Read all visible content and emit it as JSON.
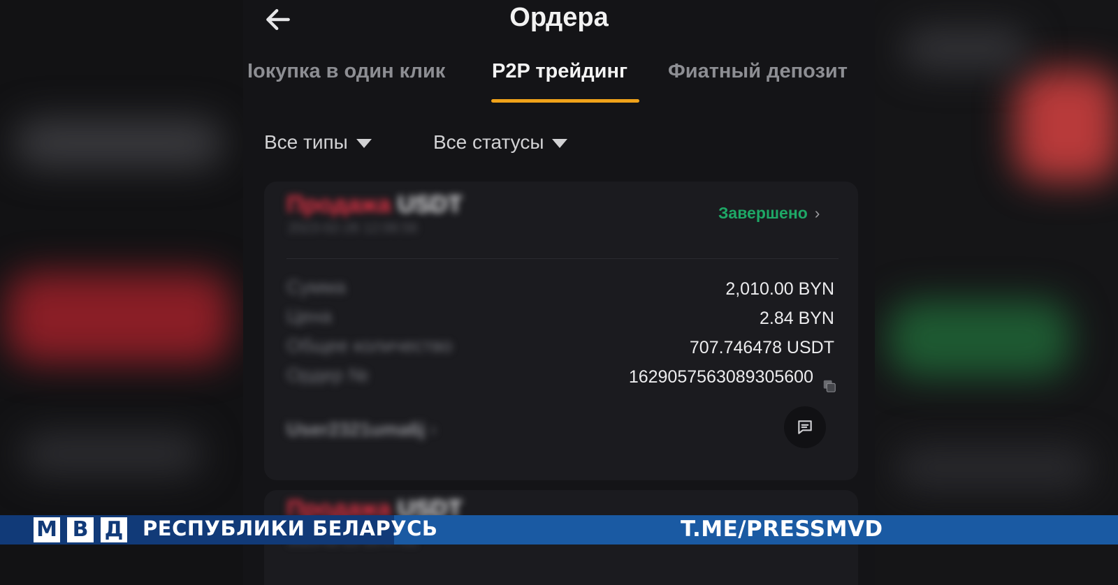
{
  "header": {
    "title": "Ордера"
  },
  "tabs": [
    {
      "label": "Іокупка в один клик"
    },
    {
      "label": "P2P трейдинг",
      "active": true
    },
    {
      "label": "Фиатный депозит"
    }
  ],
  "filters": {
    "type": "Все типы",
    "status": "Все статусы"
  },
  "order": {
    "type_sell": "Продажа",
    "asset": "USDT",
    "date": "2023-02-26 12:06:56",
    "status": "Завершено",
    "status_chevron": "›",
    "rows": [
      {
        "label": "Сумма",
        "value": "2,010.00 BYN"
      },
      {
        "label": "Цена",
        "value": "2.84 BYN"
      },
      {
        "label": "Общее количество",
        "value": "707.746478 USDT"
      },
      {
        "label": "Ордер №",
        "value": "1629057563089305600"
      }
    ],
    "user": "User2321uma6j",
    "user_chevron": "›"
  },
  "order2": {
    "type_sell": "Продажа",
    "asset": "USDT",
    "date": "2023-02-25 18:47:01"
  },
  "banner": {
    "letters": [
      "М",
      "В",
      "Д"
    ],
    "org": "РЕСПУБЛИКИ БЕЛАРУСЬ",
    "link": "T.ME/PRESSMVD"
  },
  "colors": {
    "accent": "#f0a21a",
    "status_done": "#1ea866",
    "sell": "#e03245",
    "banner_dark": "#113a78",
    "banner_light": "#1a5aa3"
  },
  "icons": {
    "back": "arrow-left-icon",
    "filter": "caret-down-icon",
    "copy": "copy-icon",
    "chat": "chat-icon"
  }
}
